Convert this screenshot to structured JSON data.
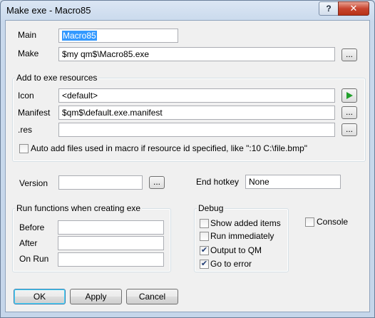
{
  "window": {
    "title": "Make exe - Macro85",
    "help": "?",
    "close": "✕"
  },
  "main": {
    "label": "Main",
    "value": "Macro85"
  },
  "make": {
    "label": "Make",
    "value": "$my qm$\\Macro85.exe",
    "browse": "..."
  },
  "resources": {
    "group_label": "Add to exe resources",
    "icon": {
      "label": "Icon",
      "value": "<default>"
    },
    "manifest": {
      "label": "Manifest",
      "value": "$qm$\\default.exe.manifest",
      "browse": "..."
    },
    "res": {
      "label": ".res",
      "value": "",
      "browse": "..."
    },
    "auto_add": {
      "label": "Auto add files used in macro if resource id specified, like \":10 C:\\file.bmp\"",
      "checked": false
    }
  },
  "version": {
    "label": "Version",
    "value": "",
    "browse": "..."
  },
  "end_hotkey": {
    "label": "End hotkey",
    "value": "None"
  },
  "run_functions": {
    "group_label": "Run functions when creating exe",
    "before": {
      "label": "Before",
      "value": ""
    },
    "after": {
      "label": "After",
      "value": ""
    },
    "on_run": {
      "label": "On Run",
      "value": ""
    }
  },
  "debug": {
    "group_label": "Debug",
    "show_added": {
      "label": "Show added items",
      "checked": false
    },
    "run_immediately": {
      "label": "Run immediately",
      "checked": false
    },
    "output_to_qm": {
      "label": "Output to QM",
      "checked": true
    },
    "go_to_error": {
      "label": "Go to error",
      "checked": true
    }
  },
  "console": {
    "label": "Console",
    "checked": false
  },
  "buttons": {
    "ok": "OK",
    "apply": "Apply",
    "cancel": "Cancel"
  },
  "colors": {
    "selection": "#3399ff",
    "play": "#22a02c",
    "close": "#c8452f"
  }
}
